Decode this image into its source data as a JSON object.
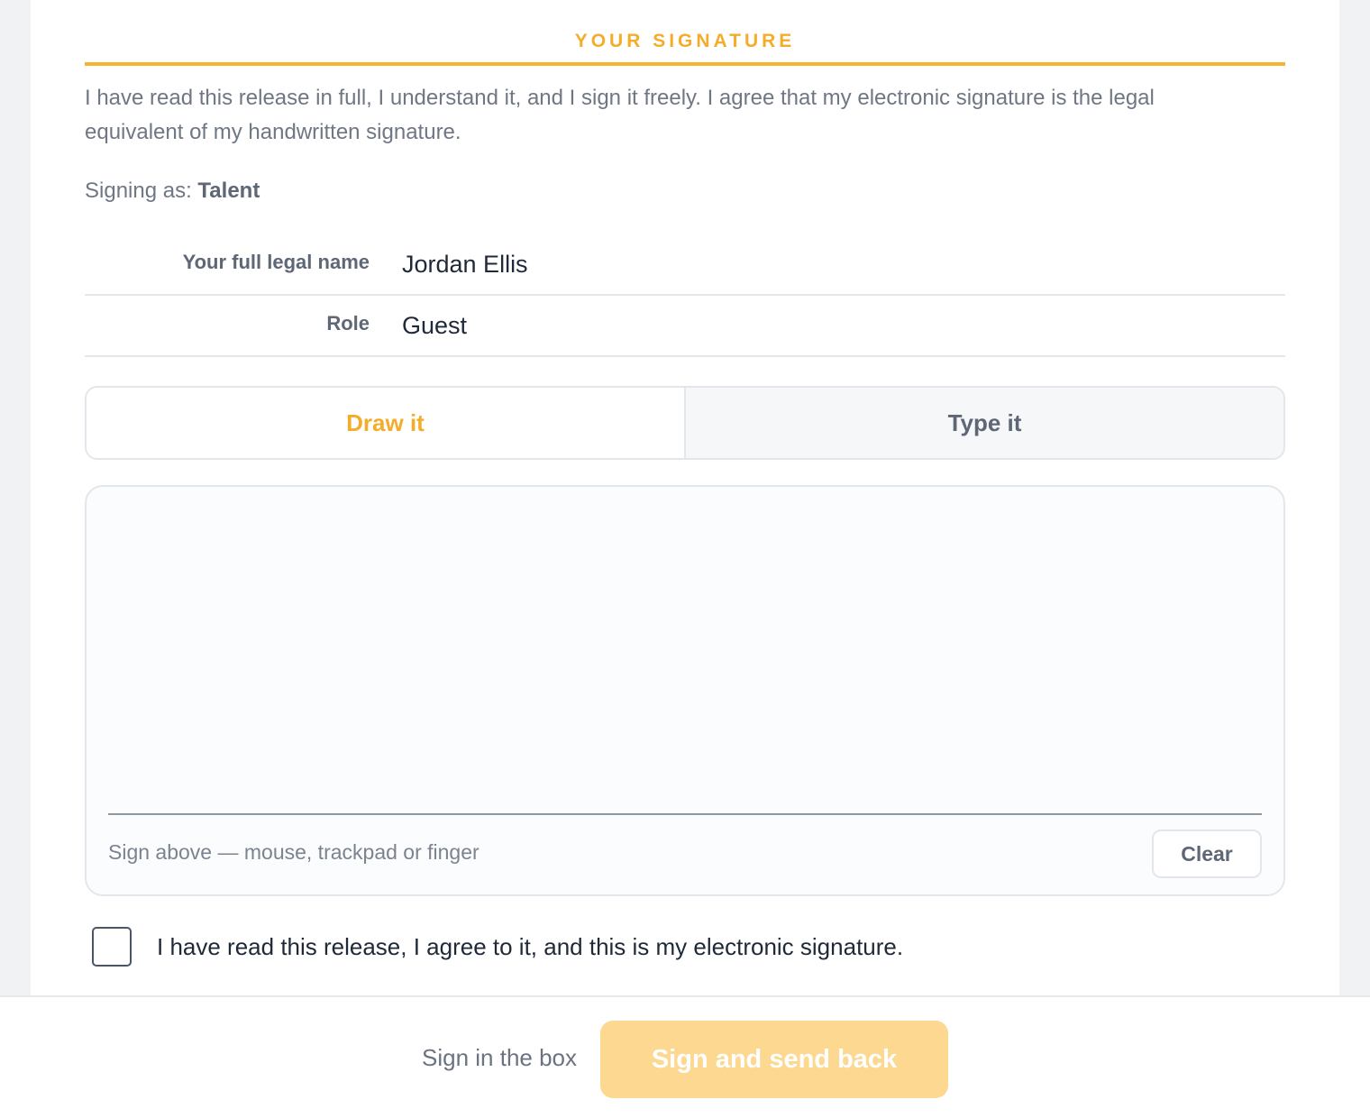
{
  "section": {
    "title": "YOUR SIGNATURE",
    "intro": "I have read this release in full, I understand it, and I sign it freely. I agree that my electronic signature is the legal equivalent of my handwritten signature.",
    "signing_as_label": "Signing as:",
    "signing_as_value": "Talent"
  },
  "fields": {
    "name_label": "Your full legal name",
    "name_value": "Jordan Ellis",
    "role_label": "Role",
    "role_value": "Guest"
  },
  "tabs": {
    "draw": "Draw it",
    "type": "Type it",
    "active": "draw"
  },
  "pad": {
    "hint": "Sign above — mouse, trackpad or finger",
    "clear_label": "Clear"
  },
  "agreement": {
    "text": "I have read this release, I agree to it, and this is my electronic signature.",
    "checked": false
  },
  "footer": {
    "status": "Sign in the box",
    "send_label": "Sign and send back"
  },
  "colors": {
    "accent": "#f3ad2a",
    "button_disabled": "#fcd890"
  }
}
